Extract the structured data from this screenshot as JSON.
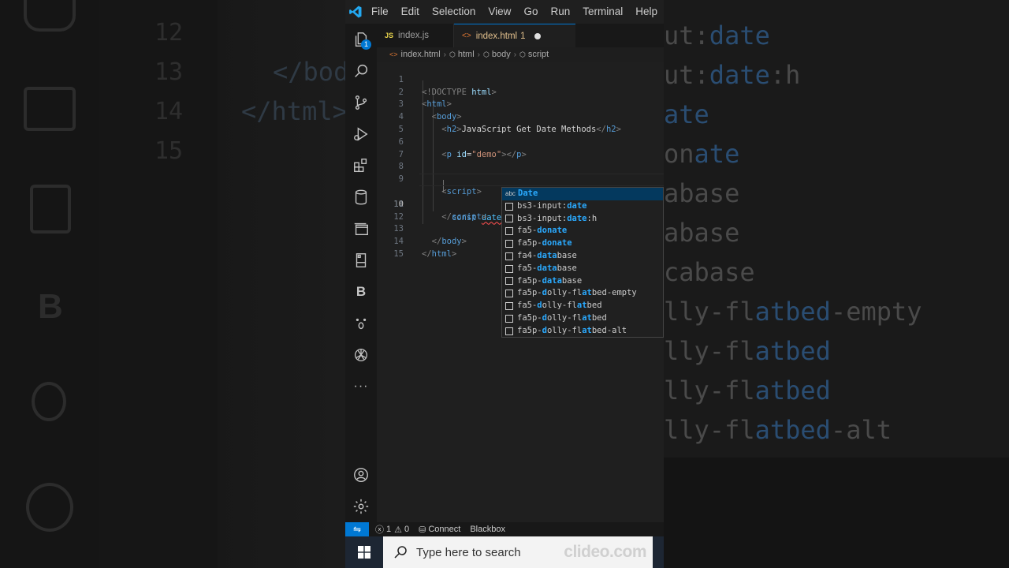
{
  "background": {
    "line_numbers": [
      "12",
      "13",
      "14",
      "15"
    ],
    "code_fragments": [
      "</bod",
      "</html>"
    ],
    "suggestion_fragments": [
      {
        "pre": "ut:",
        "hl": "date",
        "post": ""
      },
      {
        "pre": "ut:",
        "hl": "date",
        "post": ":h"
      },
      {
        "pre": "",
        "hl": "ate",
        "post": ""
      },
      {
        "pre": "on",
        "hl": "ate",
        "post": ""
      },
      {
        "pre": "abase",
        "hl": "",
        "post": ""
      },
      {
        "pre": "abase",
        "hl": "",
        "post": ""
      },
      {
        "pre": "cabase",
        "hl": "",
        "post": ""
      },
      {
        "pre": "lly-fl",
        "hl": "atbed",
        "post": "-empty"
      },
      {
        "pre": "lly-fl",
        "hl": "atbed",
        "post": ""
      },
      {
        "pre": "lly-fl",
        "hl": "atbed",
        "post": ""
      },
      {
        "pre": "lly-fl",
        "hl": "atbed",
        "post": "-alt"
      }
    ]
  },
  "titlebar": {
    "menu": [
      "File",
      "Edit",
      "Selection",
      "View",
      "Go",
      "Run",
      "Terminal",
      "Help"
    ]
  },
  "activitybar": {
    "explorer_badge": "1",
    "b_label": "B",
    "more_label": "···"
  },
  "tabs": [
    {
      "badge": "JS",
      "label": "index.js"
    },
    {
      "badge": "<>",
      "label": "index.html",
      "problems": "1"
    }
  ],
  "breadcrumbs": {
    "file": "index.html",
    "items": [
      "html",
      "body",
      "script"
    ]
  },
  "editor": {
    "current_line": "10",
    "lines": [
      {
        "n": "1"
      },
      {
        "n": "2"
      },
      {
        "n": "3"
      },
      {
        "n": "4"
      },
      {
        "n": "5"
      },
      {
        "n": "6"
      },
      {
        "n": "7"
      },
      {
        "n": "8"
      },
      {
        "n": "9"
      },
      {
        "n": "10"
      },
      {
        "n": "11"
      },
      {
        "n": "12"
      },
      {
        "n": "13"
      },
      {
        "n": "14"
      },
      {
        "n": "15"
      }
    ],
    "tokens": {
      "doctype": "<!DOCTYPE",
      "doctype_html": "html",
      "doctype_close": ">",
      "html": "html",
      "body": "body",
      "h2": "h2",
      "h2_text": "JavaScript Get Date Methods",
      "p": "p",
      "p_attr": "id",
      "p_eq": "=",
      "p_val": "\"demo\"",
      "script": "script",
      "const_kw": "const",
      "typed": "date"
    }
  },
  "suggest": {
    "items": [
      {
        "kind": "abc",
        "pre": "",
        "hl": "Date",
        "post": "",
        "selected": true
      },
      {
        "kind": "snippet",
        "pre": "bs3-input:",
        "hl": "date",
        "post": ""
      },
      {
        "kind": "snippet",
        "pre": "bs3-input:",
        "hl": "date",
        "post": ":h"
      },
      {
        "kind": "snippet",
        "pre": "fa5-",
        "hl": "donate",
        "post": ""
      },
      {
        "kind": "snippet",
        "pre": "fa5p-",
        "hl": "donate",
        "post": ""
      },
      {
        "kind": "snippet",
        "pre": "fa4-",
        "hl": "data",
        "post": "base"
      },
      {
        "kind": "snippet",
        "pre": "fa5-",
        "hl": "data",
        "post": "base"
      },
      {
        "kind": "snippet",
        "pre": "fa5p-",
        "hl": "data",
        "post": "base"
      },
      {
        "kind": "snippet",
        "pre": "fa5p-",
        "hl": "d",
        "post": "olly-fl",
        "hl2": "at",
        "post2": "bed-empty"
      },
      {
        "kind": "snippet",
        "pre": "fa5-",
        "hl": "d",
        "post": "olly-fl",
        "hl2": "at",
        "post2": "bed"
      },
      {
        "kind": "snippet",
        "pre": "fa5p-",
        "hl": "d",
        "post": "olly-fl",
        "hl2": "at",
        "post2": "bed"
      },
      {
        "kind": "snippet",
        "pre": "fa5p-",
        "hl": "d",
        "post": "olly-fl",
        "hl2": "at",
        "post2": "bed-alt"
      }
    ]
  },
  "statusbar": {
    "errors": "1",
    "warnings": "0",
    "connect": "Connect",
    "blackbox": "Blackbox"
  },
  "taskbar": {
    "search_placeholder": "Type here to search",
    "watermark": "clideo.com"
  },
  "colors": {
    "accent": "#0078d4",
    "suggest_highlight": "#2aaaff",
    "tag": "#569cd6",
    "string": "#ce9178"
  }
}
